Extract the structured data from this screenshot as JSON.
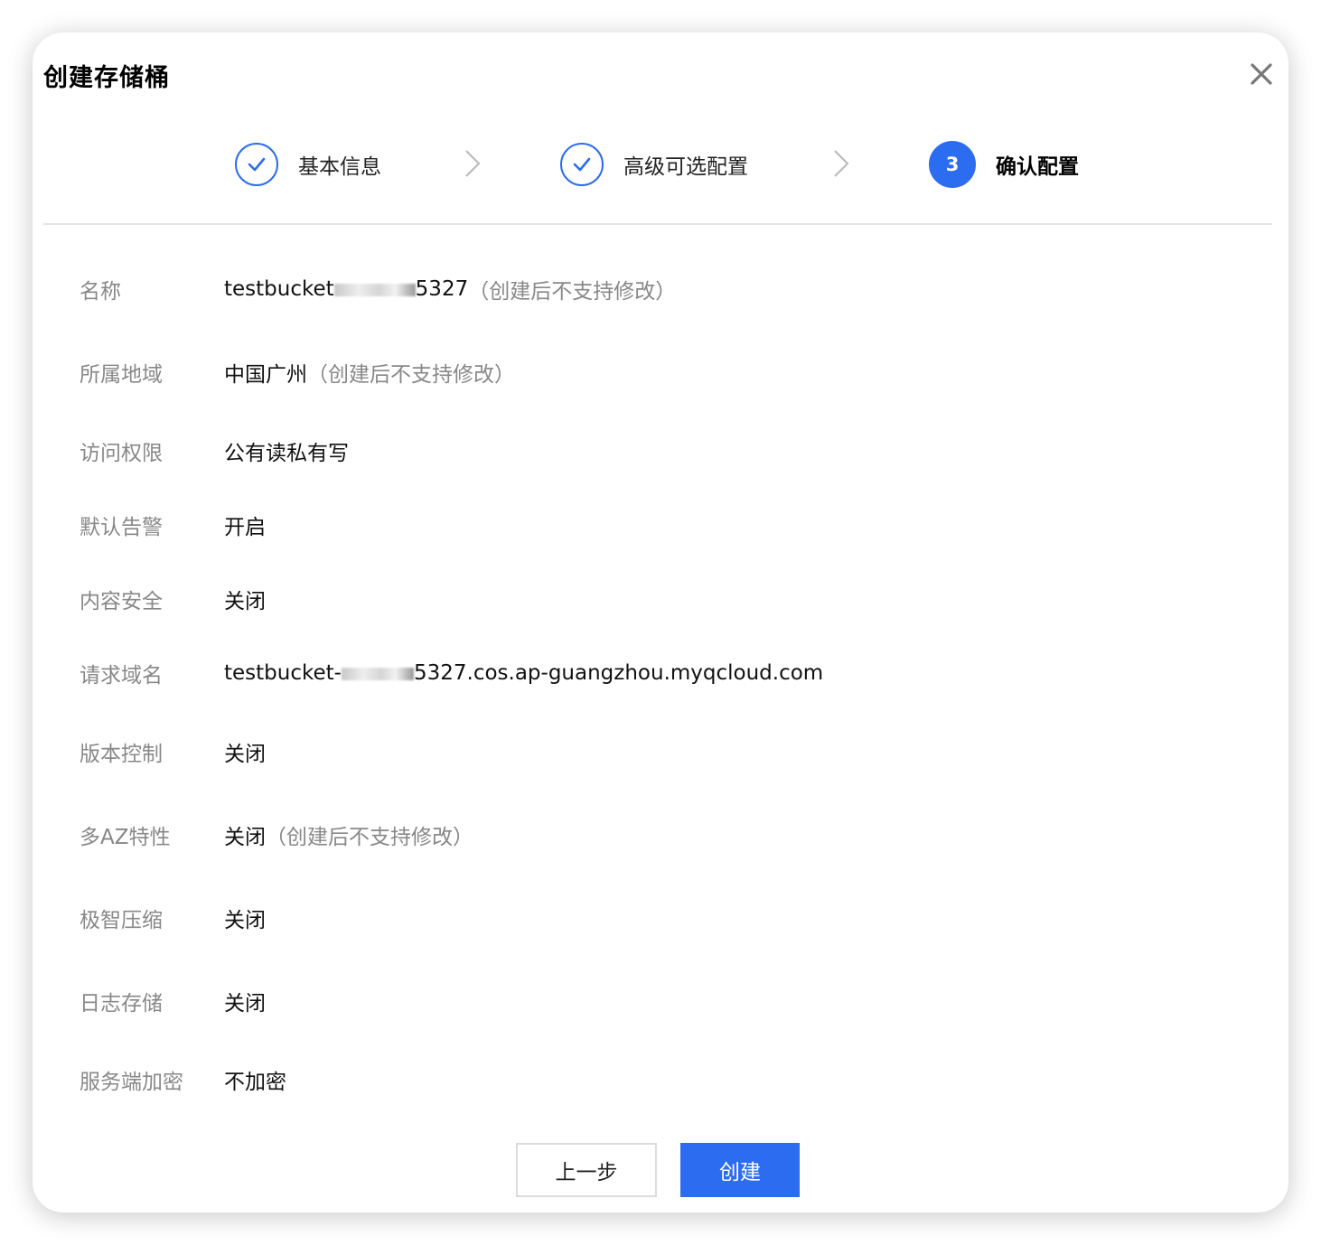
{
  "dialog": {
    "title": "创建存储桶",
    "close_icon": "close-icon"
  },
  "steps": [
    {
      "label": "基本信息",
      "state": "done",
      "icon": "check-icon"
    },
    {
      "label": "高级可选配置",
      "state": "done",
      "icon": "check-icon"
    },
    {
      "label": "确认配置",
      "state": "active",
      "number": "3"
    }
  ],
  "fields": {
    "name": {
      "label": "名称",
      "value_prefix": "testbucket",
      "value_suffix": "5327",
      "note": "（创建后不支持修改）"
    },
    "region": {
      "label": "所属地域",
      "value": "中国广州",
      "note": "（创建后不支持修改）"
    },
    "access": {
      "label": "访问权限",
      "value": "公有读私有写"
    },
    "alarm": {
      "label": "默认告警",
      "value": "开启"
    },
    "content_security": {
      "label": "内容安全",
      "value": "关闭"
    },
    "domain": {
      "label": "请求域名",
      "value_prefix": "testbucket-",
      "value_suffix": "5327.cos.ap-guangzhou.myqcloud.com"
    },
    "versioning": {
      "label": "版本控制",
      "value": "关闭"
    },
    "multi_az": {
      "label": "多AZ特性",
      "value": "关闭",
      "note": "（创建后不支持修改）"
    },
    "compression": {
      "label": "极智压缩",
      "value": "关闭"
    },
    "log_storage": {
      "label": "日志存储",
      "value": "关闭"
    },
    "encryption": {
      "label": "服务端加密",
      "value": "不加密"
    }
  },
  "buttons": {
    "prev": "上一步",
    "create": "创建"
  },
  "colors": {
    "accent": "#2c6cf0",
    "label_gray": "#888888",
    "divider": "#e3e3e3"
  }
}
